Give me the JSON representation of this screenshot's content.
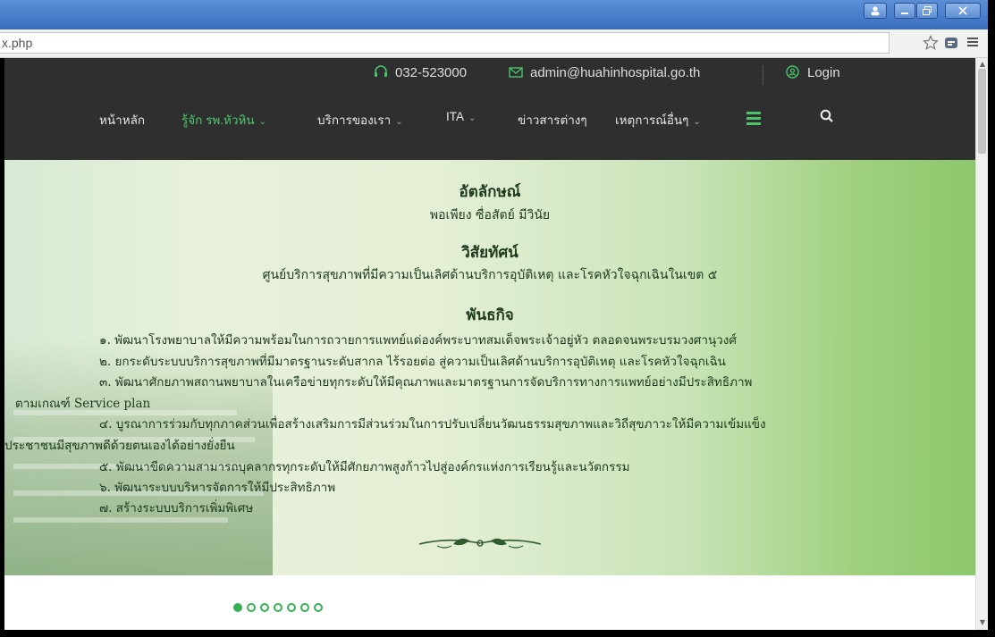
{
  "browser": {
    "window_buttons": [
      "➕",
      "–",
      "❐",
      "x"
    ],
    "url": "x.php",
    "star_icon": "star-icon",
    "extension_icon": "extension-icon",
    "menu_icon": "hamburger-icon"
  },
  "site": {
    "topbar": {
      "phone": "032-523000",
      "email": "admin@huahinhospital.go.th",
      "login": "Login"
    },
    "nav": [
      {
        "label": "หน้าหลัก",
        "has_dropdown": false
      },
      {
        "label": "รู้จัก รพ.หัวหิน",
        "has_dropdown": true,
        "active": true
      },
      {
        "label": "บริการของเรา",
        "has_dropdown": true
      },
      {
        "label": "ITA",
        "has_dropdown": true
      },
      {
        "label": "ข่าวสารต่างๆ",
        "has_dropdown": false
      },
      {
        "label": "เหตุการณ์อื่นๆ",
        "has_dropdown": true
      }
    ],
    "chevron": "⌄",
    "accent_color": "#4fc86e"
  },
  "hero": {
    "identity_title": "อัตลักษณ์",
    "identity_text": "พอเพียง ซื่อสัตย์ มีวินัย",
    "vision_title": "วิสัยทัศน์",
    "vision_text": "ศูนย์บริการสุขภาพที่มีความเป็นเลิศด้านบริการอุบัติเหตุ และโรคหัวใจฉุกเฉินในเขต ๕",
    "mission_title": "พันธกิจ",
    "mission_lines": [
      "๑. พัฒนาโรงพยาบาลให้มีความพร้อมในการถวายการแพทย์แด่องค์พระบาทสมเด็จพระเจ้าอยู่หัว ตลอดจนพระบรมวงศานุวงศ์",
      "๒. ยกระดับระบบบริการสุขภาพที่มีมาตรฐานระดับสากล ไร้รอยต่อ สู่ความเป็นเลิศด้านบริการอุบัติเหตุ และโรคหัวใจฉุกเฉิน",
      "๓. พัฒนาศักยภาพสถานพยาบาลในเครือข่ายทุกระดับให้มีคุณภาพและมาตรฐานการจัดบริการทางการแพทย์อย่างมีประสิทธิภาพ",
      "ตามเกณฑ์ Service plan",
      "๔. บูรณาการร่วมกับทุกภาคส่วนเพื่อสร้างเสริมการมีส่วนร่วมในการปรับเปลี่ยนวัฒนธรรมสุขภาพและวิถีสุขภาวะให้มีความเข้มแข็ง",
      "ประชาชนมีสุขภาพดีด้วยตนเองได้อย่างยั่งยืน",
      "๕. พัฒนาขีดความสามารถบุคลากรทุกระดับให้มีศักยภาพสูงก้าวไปสู่องค์กรแห่งการเรียนรู้และนวัตกรรม",
      "๖. พัฒนาระบบบริหารจัดการให้มีประสิทธิภาพ",
      "๗. สร้างระบบบริการเพิ่มพิเศษ"
    ]
  },
  "slider": {
    "count": 7,
    "active_index": 0
  }
}
